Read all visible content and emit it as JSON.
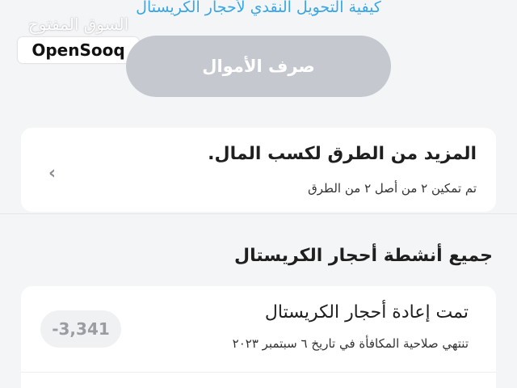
{
  "header": {
    "how_to_link": "كيفية التحويل النقدي لأحجار الكريستال",
    "exchange_button": "صرف الأموال"
  },
  "watermark": {
    "arabic": "السوق المفتوح",
    "brand": "OpenSooq"
  },
  "more_ways": {
    "title": "المزيد من الطرق لكسب المال.",
    "subtitle": "تم تمكين ٢ من أصل ٢ من الطرق"
  },
  "activities": {
    "section_title": "جميع أنشطة أحجار الكريستال",
    "items": [
      {
        "title": "تمت إعادة أحجار الكريستال",
        "subtitle": "تنتهي صلاحية المكافأة في تاريخ ٦ سبتمبر ٢٠٢٣",
        "amount": "-3,341"
      }
    ]
  },
  "icons": {
    "chevron": "chevron-left-icon"
  },
  "colors": {
    "link": "#3aa6e3",
    "button_bg": "#c5c8cf",
    "page_bg": "#f4f5f7"
  }
}
